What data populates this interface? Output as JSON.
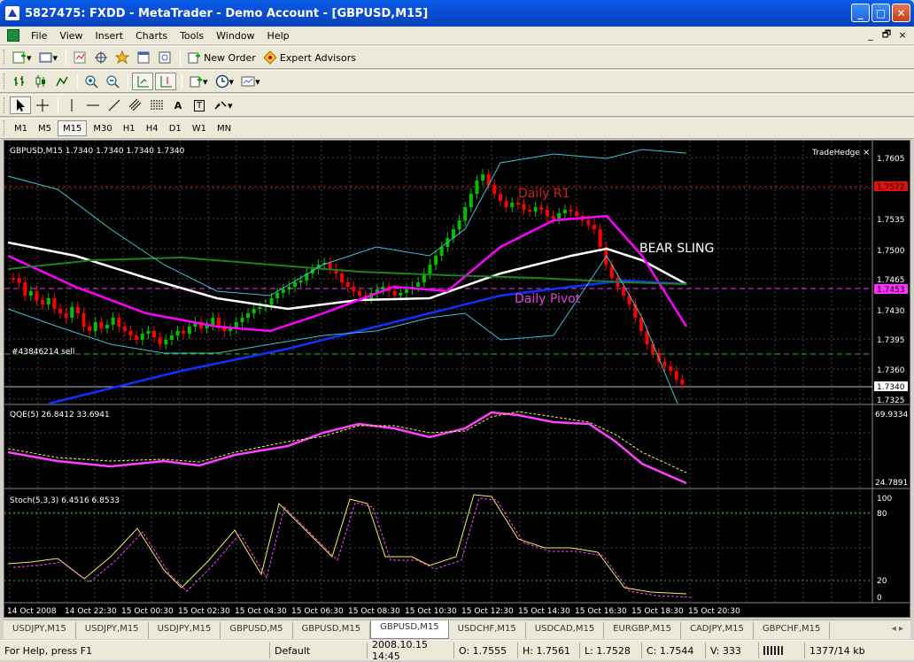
{
  "window": {
    "title": "5827475: FXDD - MetaTrader - Demo Account - [GBPUSD,M15]",
    "minimize": "_",
    "maximize": "□",
    "close": "✕"
  },
  "menu": {
    "items": [
      "File",
      "View",
      "Insert",
      "Charts",
      "Tools",
      "Window",
      "Help"
    ],
    "mdi": [
      "_",
      "🗗",
      "×"
    ]
  },
  "toolbar1": {
    "new_order_label": "New Order",
    "expert_advisors_label": "Expert Advisors"
  },
  "toolbar3": {
    "text_tool": "A",
    "label_tool": "T"
  },
  "timeframes": [
    "M1",
    "M5",
    "M15",
    "M30",
    "H1",
    "H4",
    "D1",
    "W1",
    "MN"
  ],
  "active_timeframe": "M15",
  "chart": {
    "header": "GBPUSD,M15  1.7340 1.7340 1.7340 1.7340",
    "tradehedge_label": "TradeHedge",
    "tradehedge_close": "×",
    "annotations": {
      "daily_r1": "Daily R1",
      "daily_pivot": "Daily Pivot",
      "bear_sling": "BEAR SLING",
      "order_label": "#43846214 sell"
    },
    "price_axis": [
      "1.7605",
      "1.7535",
      "1.7500",
      "1.7465",
      "1.7430",
      "1.7395",
      "1.7360",
      "1.7325"
    ],
    "price_markers": {
      "r1": "1.7572",
      "pivot": "1.7453",
      "current": "1.7340"
    },
    "qqe": {
      "header": "QQE(5) 26.8412 33.6941",
      "top": "69.9334",
      "bottom": "24.7891"
    },
    "stoch": {
      "header": "Stoch(5,3,3) 6.4516 6.8533",
      "ticks": [
        "100",
        "80",
        "20",
        "0"
      ]
    },
    "time_axis": [
      "14 Oct 2008",
      "14 Oct 22:30",
      "15 Oct 00:30",
      "15 Oct 02:30",
      "15 Oct 04:30",
      "15 Oct 06:30",
      "15 Oct 08:30",
      "15 Oct 10:30",
      "15 Oct 12:30",
      "15 Oct 14:30",
      "15 Oct 16:30",
      "15 Oct 18:30",
      "15 Oct 20:30"
    ],
    "colors": {
      "background": "#000000",
      "bull_candle": "#00c000",
      "bear_candle": "#ff0000",
      "bollinger": "#40c0d0",
      "ma_white": "#ffffff",
      "ma_magenta": "#ff00ff",
      "ma_blue": "#1030ff",
      "ma_green": "#208020",
      "stoch_main": "#f0f060",
      "stoch_signal": "#ff40ff"
    }
  },
  "tabs": [
    "USDJPY,M15",
    "USDJPY,M15",
    "USDJPY,M15",
    "GBPUSD,M5",
    "GBPUSD,M15",
    "GBPUSD,M15",
    "USDCHF,M15",
    "USDCAD,M15",
    "EURGBP,M15",
    "CADJPY,M15",
    "GBPCHF,M15"
  ],
  "active_tab_index": 5,
  "tab_scroll": "◂ ▸",
  "status": {
    "help": "For Help, press F1",
    "profile": "Default",
    "datetime": "2008.10.15 14:45",
    "open": "O: 1.7555",
    "high": "H: 1.7561",
    "low": "L: 1.7528",
    "close": "C: 1.7544",
    "volume": "V: 333",
    "traffic": "1377/14 kb"
  }
}
